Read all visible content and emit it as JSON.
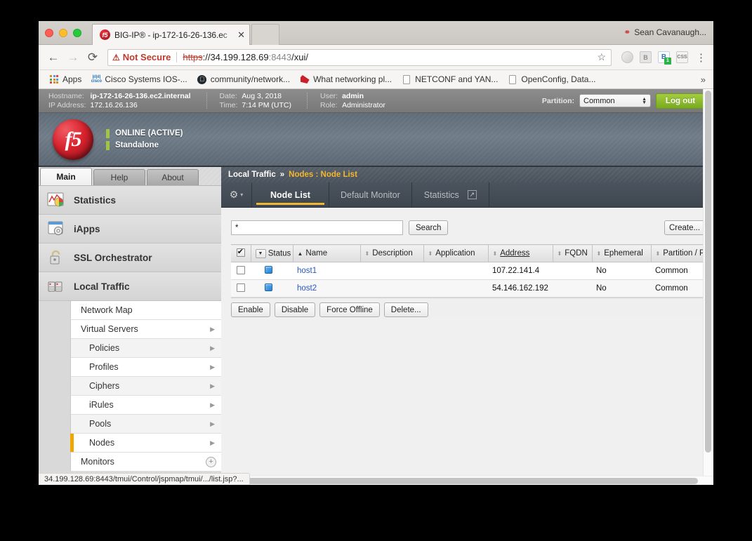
{
  "browser": {
    "tab": {
      "title": "BIG-IP® - ip-172-16-26-136.ec",
      "close": "✕",
      "favicon": "f5-favicon"
    },
    "user_chip": {
      "sync_icon": "sync-icon",
      "name": "Sean Cavanaugh..."
    },
    "nav": {
      "back": "←",
      "forward": "→",
      "reload": "⟳"
    },
    "omnibox": {
      "security_icon": "⚠",
      "security_label": "Not Secure",
      "scheme": "https",
      "separator": "://",
      "host": "34.199.128.69",
      "port": ":8443",
      "path": "/xui/",
      "star": "☆"
    },
    "extensions": [
      "moon-icon",
      "b-icon",
      "b-badge-icon",
      "css-icon"
    ],
    "extension_badge": "1",
    "menu": "⋮",
    "bookmarks": [
      {
        "label": "Apps",
        "icon": "apps-grid-icon"
      },
      {
        "label": "Cisco Systems IOS-...",
        "icon": "cisco-icon"
      },
      {
        "label": "community/network...",
        "icon": "github-icon"
      },
      {
        "label": "What networking pl...",
        "icon": "red-page-icon"
      },
      {
        "label": "NETCONF and YAN...",
        "icon": "document-icon"
      },
      {
        "label": "OpenConfig, Data...",
        "icon": "document-icon"
      }
    ],
    "bookmarks_overflow": "»",
    "status_bubble": "34.199.128.69:8443/tmui/Control/jspmap/tmui/.../list.jsp?..."
  },
  "infobar": {
    "hostname_label": "Hostname:",
    "hostname_value": "ip-172-16-26-136.ec2.internal",
    "ip_label": "IP Address:",
    "ip_value": "172.16.26.136",
    "date_label": "Date:",
    "date_value": "Aug 3, 2018",
    "time_label": "Time:",
    "time_value": "7:14 PM (UTC)",
    "user_label": "User:",
    "user_value": "admin",
    "role_label": "Role:",
    "role_value": "Administrator",
    "partition_label": "Partition:",
    "partition_value": "Common",
    "partition_options": [
      "Common"
    ],
    "logout_label": "Log out"
  },
  "banner": {
    "logo": "f5",
    "status_primary": "ONLINE (ACTIVE)",
    "status_secondary": "Standalone",
    "accent_green": "#a0c544"
  },
  "sidebar": {
    "tabs": [
      {
        "label": "Main",
        "active": true
      },
      {
        "label": "Help",
        "active": false
      },
      {
        "label": "About",
        "active": false
      }
    ],
    "modules": [
      {
        "label": "Statistics",
        "icon": "statistics-icon"
      },
      {
        "label": "iApps",
        "icon": "iapps-icon"
      },
      {
        "label": "SSL Orchestrator",
        "icon": "padlock-icon"
      },
      {
        "label": "Local Traffic",
        "icon": "local-traffic-icon"
      }
    ],
    "local_traffic_items": [
      {
        "label": "Network Map",
        "arrow": false,
        "indent": 0,
        "active": false
      },
      {
        "label": "Virtual Servers",
        "arrow": true,
        "indent": 0,
        "active": false
      },
      {
        "label": "Policies",
        "arrow": true,
        "indent": 1,
        "active": false
      },
      {
        "label": "Profiles",
        "arrow": true,
        "indent": 1,
        "active": false
      },
      {
        "label": "Ciphers",
        "arrow": true,
        "indent": 1,
        "active": false
      },
      {
        "label": "iRules",
        "arrow": true,
        "indent": 1,
        "active": false
      },
      {
        "label": "Pools",
        "arrow": true,
        "indent": 1,
        "active": false
      },
      {
        "label": "Nodes",
        "arrow": true,
        "indent": 1,
        "active": true
      },
      {
        "label": "Monitors",
        "arrow": false,
        "indent": 0,
        "active": false,
        "plus": "+"
      }
    ]
  },
  "content": {
    "breadcrumb": {
      "module": "Local Traffic",
      "separator": "»",
      "page": "Nodes : Node List"
    },
    "gear_icon": "gear-icon",
    "gear_caret": "▾",
    "tabs": [
      {
        "label": "Node List",
        "active": true,
        "popout": false
      },
      {
        "label": "Default Monitor",
        "active": false,
        "popout": false
      },
      {
        "label": "Statistics",
        "active": false,
        "popout": true
      }
    ],
    "popout_icon": "↗",
    "search": {
      "value": "*",
      "button": "Search"
    },
    "create_label": "Create...",
    "table": {
      "columns": [
        {
          "label": "",
          "type": "checkbox",
          "checked": true
        },
        {
          "label": "Status",
          "type": "dropdown",
          "sort": "none"
        },
        {
          "label": "Name",
          "sort": "asc"
        },
        {
          "label": "Description",
          "sort": "none"
        },
        {
          "label": "Application",
          "sort": "none"
        },
        {
          "label": "Address",
          "sort": "none",
          "underline": true
        },
        {
          "label": "FQDN",
          "sort": "none"
        },
        {
          "label": "Ephemeral",
          "sort": "none"
        },
        {
          "label": "Partition / Path",
          "sort": "none"
        }
      ],
      "rows": [
        {
          "checked": false,
          "status": "blue-square",
          "name": "host1",
          "description": "",
          "application": "",
          "address": "107.22.141.4",
          "fqdn": "",
          "ephemeral": "No",
          "partition": "Common"
        },
        {
          "checked": false,
          "status": "blue-square",
          "name": "host2",
          "description": "",
          "application": "",
          "address": "54.146.162.192",
          "fqdn": "",
          "ephemeral": "No",
          "partition": "Common"
        }
      ]
    },
    "actions": [
      "Enable",
      "Disable",
      "Force Offline",
      "Delete..."
    ]
  }
}
